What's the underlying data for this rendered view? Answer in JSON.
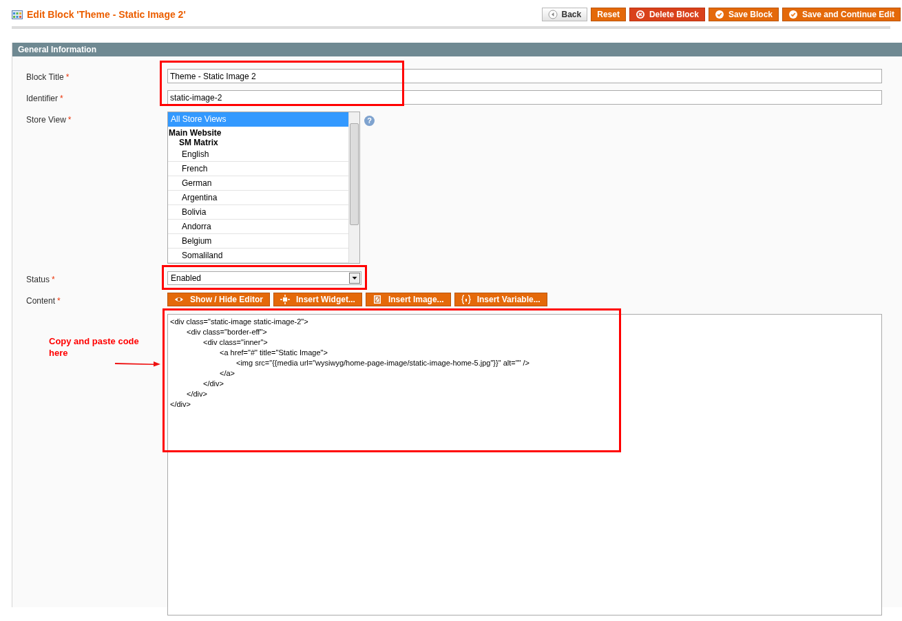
{
  "header": {
    "title": "Edit Block 'Theme - Static Image 2'",
    "buttons": [
      {
        "label": "Back",
        "kind": "back"
      },
      {
        "label": "Reset",
        "kind": "plain"
      },
      {
        "label": "Delete Block",
        "kind": "delete"
      },
      {
        "label": "Save Block",
        "kind": "save"
      },
      {
        "label": "Save and Continue Edit",
        "kind": "save"
      }
    ]
  },
  "section": {
    "title": "General Information"
  },
  "fields": {
    "block_title": {
      "label": "Block Title",
      "required_mark": "*",
      "value": "Theme - Static Image 2"
    },
    "identifier": {
      "label": "Identifier",
      "required_mark": "*",
      "value": "static-image-2"
    },
    "store_view": {
      "label": "Store View",
      "required_mark": "*",
      "help": "?",
      "options": [
        {
          "label": "All Store Views",
          "selected": true
        },
        {
          "label": "Main Website",
          "children": [
            {
              "label": "SM Matrix",
              "children": [
                {
                  "label": "English",
                  "selected": false
                },
                {
                  "label": "French",
                  "selected": false
                },
                {
                  "label": "German",
                  "selected": false
                },
                {
                  "label": "Argentina",
                  "selected": false
                },
                {
                  "label": "Bolivia",
                  "selected": false
                },
                {
                  "label": "Andorra",
                  "selected": false
                },
                {
                  "label": "Belgium",
                  "selected": false
                },
                {
                  "label": "Somaliland",
                  "selected": false
                }
              ]
            }
          ]
        }
      ]
    },
    "status": {
      "label": "Status",
      "required_mark": "*",
      "value": "Enabled"
    },
    "content": {
      "label": "Content",
      "required_mark": "*",
      "buttons": [
        {
          "label": "Show / Hide Editor",
          "kind": "eye"
        },
        {
          "label": "Insert Widget...",
          "kind": "widget"
        },
        {
          "label": "Insert Image...",
          "kind": "image"
        },
        {
          "label": "Insert Variable...",
          "kind": "variable"
        }
      ],
      "value": "<div class=\"static-image static-image-2\">\n\t<div class=\"border-eff\">\n\t\t<div class=\"inner\">\n\t\t\t<a href=\"#\" title=\"Static Image\">\n\t\t\t\t<img src=\"{{media url=\"wysiwyg/home-page-image/static-image-home-5.jpg\"}}\" alt=\"\" />\n\t\t\t</a>\n\t\t</div>\n\t</div>\n</div>"
    }
  },
  "annotation": {
    "text": "Copy and paste code here"
  }
}
